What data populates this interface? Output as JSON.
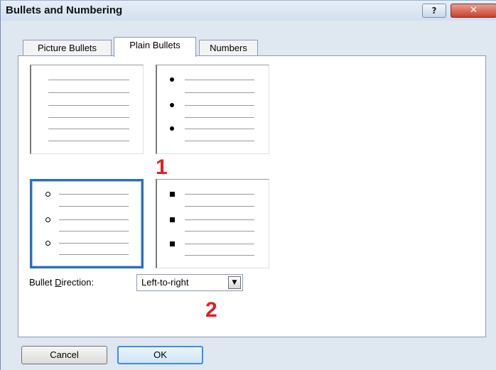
{
  "window": {
    "title": "Bullets and Numbering",
    "help_label": "?",
    "close_label": "✕"
  },
  "tabs": [
    {
      "label": "Picture Bullets",
      "active": false
    },
    {
      "label": "Plain Bullets",
      "active": true
    },
    {
      "label": "Numbers",
      "active": false
    }
  ],
  "bullet_styles": [
    {
      "name": "none",
      "selected": false
    },
    {
      "name": "filled-dot",
      "selected": false
    },
    {
      "name": "hollow-circle",
      "selected": true
    },
    {
      "name": "filled-square",
      "selected": false
    }
  ],
  "annotations": {
    "marker_1": "1",
    "marker_2": "2",
    "color": "#e02020"
  },
  "bullet_direction": {
    "label_before": "Bullet ",
    "label_underlined": "D",
    "label_after": "irection:",
    "value": "Left-to-right",
    "arrow_icon": "chevron-down-icon"
  },
  "buttons": {
    "cancel": "Cancel",
    "ok": "OK"
  },
  "colors": {
    "selection_border": "#2a6fbf",
    "dialog_bg": "#dfe7f1"
  }
}
